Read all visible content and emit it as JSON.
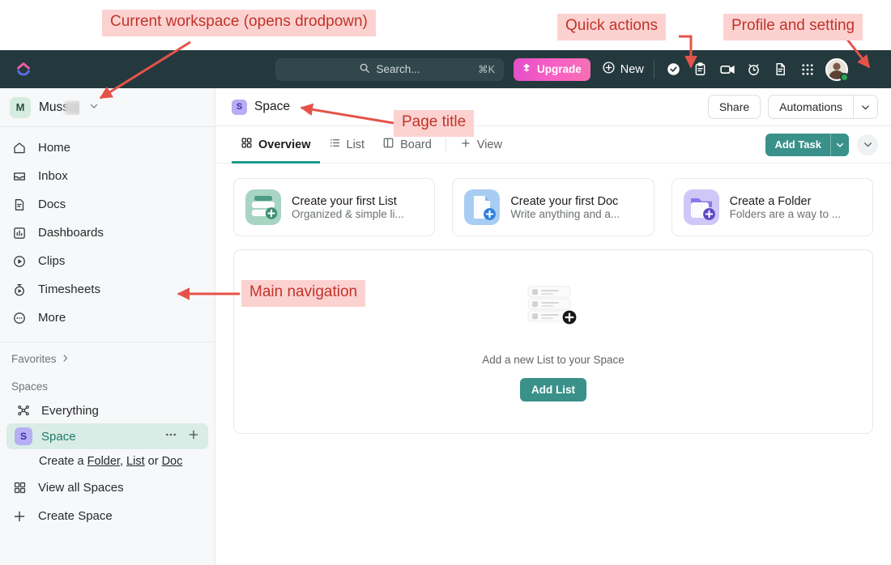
{
  "annotations": [
    {
      "id": "workspace",
      "text": "Current workspace (opens drodpown)"
    },
    {
      "id": "quick_actions",
      "text": "Quick actions"
    },
    {
      "id": "profile",
      "text": "Profile and setting"
    },
    {
      "id": "page_title",
      "text": "Page title"
    },
    {
      "id": "main_nav",
      "text": "Main navigation"
    }
  ],
  "topbar": {
    "logo_icon": "clickup-logo-icon",
    "search": {
      "placeholder": "Search...",
      "shortcut": "⌘K",
      "icon": "search-icon"
    },
    "upgrade_label": "Upgrade",
    "upgrade_icon": "upgrade-rocket-icon",
    "new_label": "New",
    "new_icon": "plus-circle-icon",
    "quick_icons": [
      {
        "name": "task-check-icon"
      },
      {
        "name": "clipboard-icon"
      },
      {
        "name": "video-camera-icon"
      },
      {
        "name": "alarm-clock-icon"
      },
      {
        "name": "document-icon"
      },
      {
        "name": "apps-grid-icon"
      }
    ],
    "avatar": {
      "name": "user-avatar",
      "status": "online"
    }
  },
  "sidebar": {
    "workspace": {
      "initial": "M",
      "name": "Mus",
      "name_suffix": "s...",
      "chevron": "chevron-down-icon"
    },
    "nav_items": [
      {
        "label": "Home",
        "icon": "home-icon"
      },
      {
        "label": "Inbox",
        "icon": "inbox-icon"
      },
      {
        "label": "Docs",
        "icon": "docs-icon"
      },
      {
        "label": "Dashboards",
        "icon": "dashboards-icon"
      },
      {
        "label": "Clips",
        "icon": "clips-icon"
      },
      {
        "label": "Timesheets",
        "icon": "timesheets-icon"
      },
      {
        "label": "More",
        "icon": "more-dots-icon"
      }
    ],
    "favorites_label": "Favorites",
    "favorites_chevron": "chevron-right-icon",
    "spaces_label": "Spaces",
    "everything": {
      "label": "Everything",
      "icon": "everything-icon"
    },
    "space": {
      "label": "Space",
      "badge": "S",
      "more_icon": "ellipsis-icon",
      "add_icon": "plus-icon"
    },
    "create_line": {
      "prefix": "Create a ",
      "folder": "Folder",
      "sep1": ", ",
      "list": "List",
      "sep2": " or ",
      "doc": "Doc"
    },
    "view_all": {
      "label": "View all Spaces",
      "icon": "grid-squares-icon"
    },
    "create_space": {
      "label": "Create Space",
      "icon": "plus-icon"
    }
  },
  "main": {
    "page_title": {
      "label": "Space",
      "badge": "S"
    },
    "share_label": "Share",
    "automations_label": "Automations",
    "automations_chevron": "chevron-down-icon",
    "tabs": [
      {
        "label": "Overview",
        "icon": "overview-icon",
        "active": true
      },
      {
        "label": "List",
        "icon": "list-icon",
        "active": false
      },
      {
        "label": "Board",
        "icon": "board-icon",
        "active": false
      }
    ],
    "add_view_label": "View",
    "add_view_icon": "plus-icon",
    "add_task_label": "Add Task",
    "add_task_caret": "chevron-down-icon",
    "collapse_chevron": "chevron-down-icon",
    "cards": [
      {
        "title": "Create your first List",
        "subtitle": "Organized & simple li...",
        "icon": "list-card-icon",
        "color": "#9ecdbb"
      },
      {
        "title": "Create your first Doc",
        "subtitle": "Write anything and a...",
        "icon": "doc-card-icon",
        "color": "#a9cdf2"
      },
      {
        "title": "Create a Folder",
        "subtitle": "Folders are a way to ...",
        "icon": "folder-card-icon",
        "color": "#cfc8f7"
      }
    ],
    "empty_state": {
      "illustration": "list-stack-illustration",
      "text": "Add a new List to your Space",
      "button_label": "Add List"
    }
  },
  "colors": {
    "topbar_bg": "#24393d",
    "accent_teal": "#39918a",
    "upgrade_pink": "#f45fc0",
    "annotation_bg": "#fcd2d0",
    "annotation_text": "#c0342b",
    "space_active_bg": "#d9ece6",
    "space_badge": "#b7aef4"
  }
}
